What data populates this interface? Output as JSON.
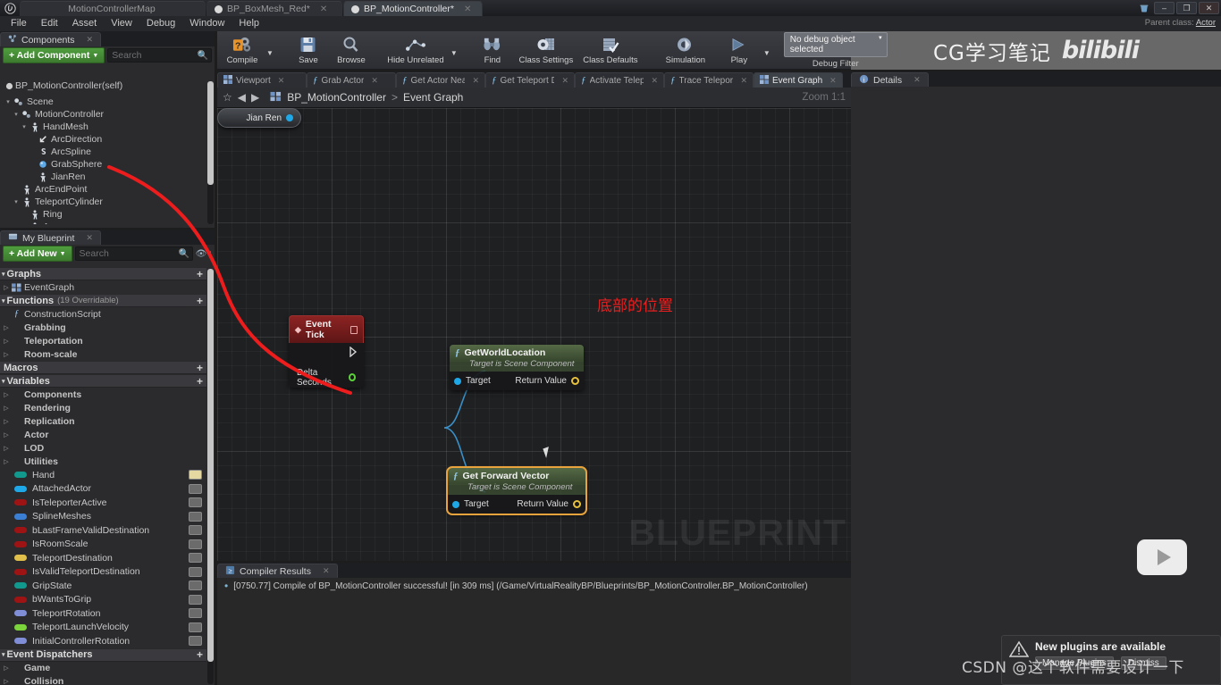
{
  "window": {
    "logo_icon": "unreal-engine-logo",
    "tabs": [
      {
        "label": "MotionControllerMap",
        "active": false,
        "has_dot": false,
        "closable": false
      },
      {
        "label": "BP_BoxMesh_Red*",
        "active": false,
        "has_dot": true,
        "closable": true
      },
      {
        "label": "BP_MotionController*",
        "active": true,
        "has_dot": true,
        "closable": true
      }
    ],
    "controls": {
      "minimize": "–",
      "maximize": "❐",
      "close": "✕",
      "recycle_icon": "recycle-bin-icon"
    }
  },
  "menubar": {
    "items": [
      "File",
      "Edit",
      "Asset",
      "View",
      "Debug",
      "Window",
      "Help"
    ],
    "parent_class_label": "Parent class:",
    "parent_class_value": "Actor"
  },
  "banner": {
    "text": "CG学习笔记",
    "brand": "bilibili"
  },
  "toolbar": {
    "buttons": [
      {
        "label": "Compile",
        "icon": "compile-icon",
        "dropdown": true
      },
      {
        "label": "Save",
        "icon": "save-icon",
        "dropdown": false
      },
      {
        "label": "Browse",
        "icon": "browse-icon",
        "dropdown": false
      },
      {
        "label": "Hide Unrelated",
        "icon": "hide-unrelated-icon",
        "dropdown": true
      },
      {
        "label": "Find",
        "icon": "find-icon",
        "dropdown": false
      },
      {
        "label": "Class Settings",
        "icon": "class-settings-icon",
        "dropdown": false
      },
      {
        "label": "Class Defaults",
        "icon": "class-defaults-icon",
        "dropdown": false
      },
      {
        "label": "Simulation",
        "icon": "simulation-icon",
        "dropdown": false
      },
      {
        "label": "Play",
        "icon": "play-icon",
        "dropdown": true
      }
    ],
    "debug_object_value": "No debug object selected",
    "debug_filter_label": "Debug Filter"
  },
  "components_panel": {
    "tab_label": "Components",
    "tab_icon": "components-icon",
    "add_button": "+ Add Component",
    "search_placeholder": "Search",
    "root": "BP_MotionController(self)",
    "tree": [
      {
        "label": "Scene",
        "depth": 1,
        "arrow": "▾",
        "icon": "scene-icon"
      },
      {
        "label": "MotionController",
        "depth": 2,
        "arrow": "▾",
        "icon": "scene-icon"
      },
      {
        "label": "HandMesh",
        "depth": 3,
        "arrow": "▾",
        "icon": "mesh-icon"
      },
      {
        "label": "ArcDirection",
        "depth": 4,
        "arrow": "",
        "icon": "arrow-icon"
      },
      {
        "label": "ArcSpline",
        "depth": 4,
        "arrow": "",
        "icon": "spline-icon"
      },
      {
        "label": "GrabSphere",
        "depth": 4,
        "arrow": "",
        "icon": "sphere-icon"
      },
      {
        "label": "JianRen",
        "depth": 4,
        "arrow": "",
        "icon": "mesh-icon"
      },
      {
        "label": "ArcEndPoint",
        "depth": 2,
        "arrow": "",
        "icon": "mesh-icon"
      },
      {
        "label": "TeleportCylinder",
        "depth": 2,
        "arrow": "▾",
        "icon": "mesh-icon"
      },
      {
        "label": "Ring",
        "depth": 3,
        "arrow": "",
        "icon": "mesh-icon"
      },
      {
        "label": "Arrow",
        "depth": 3,
        "arrow": "▾",
        "icon": "mesh-icon"
      }
    ]
  },
  "myblueprint_panel": {
    "tab_label": "My Blueprint",
    "tab_icon": "blueprint-icon",
    "add_button": "+ Add New",
    "search_placeholder": "Search",
    "eye_icon": "visibility-icon",
    "sections": [
      {
        "title": "Graphs",
        "arrow": "▾",
        "note": "",
        "plus": true
      },
      {
        "title": "Functions",
        "arrow": "▾",
        "note": "(19 Overridable)",
        "plus": true
      },
      {
        "title": "Macros",
        "arrow": "",
        "note": "",
        "plus": true
      },
      {
        "title": "Variables",
        "arrow": "▾",
        "note": "",
        "plus": true
      },
      {
        "title": "Event Dispatchers",
        "arrow": "▾",
        "note": "",
        "plus": true
      }
    ],
    "graphs": [
      {
        "label": "EventGraph",
        "arrow": "▷",
        "icon": "eventgraph-icon"
      }
    ],
    "functions": [
      {
        "label": "ConstructionScript",
        "arrow": "",
        "icon": "function-icon"
      },
      {
        "label": "Grabbing",
        "arrow": "▷",
        "icon": ""
      },
      {
        "label": "Teleportation",
        "arrow": "▷",
        "icon": ""
      },
      {
        "label": "Room-scale",
        "arrow": "▷",
        "icon": ""
      }
    ],
    "variable_categories": [
      {
        "label": "Components",
        "arrow": "▷"
      },
      {
        "label": "Rendering",
        "arrow": "▷"
      },
      {
        "label": "Replication",
        "arrow": "▷"
      },
      {
        "label": "Actor",
        "arrow": "▷"
      },
      {
        "label": "LOD",
        "arrow": "▷"
      },
      {
        "label": "Utilities",
        "arrow": "▷"
      }
    ],
    "variables": [
      {
        "label": "Hand",
        "color": "#11998e",
        "eye_on": true
      },
      {
        "label": "AttachedActor",
        "color": "#1fa8e8",
        "eye_on": false
      },
      {
        "label": "IsTeleporterActive",
        "color": "#9e1414",
        "eye_on": false
      },
      {
        "label": "SplineMeshes",
        "color": "#3b7fd4",
        "eye_on": false
      },
      {
        "label": "bLastFrameValidDestination",
        "color": "#9e1414",
        "eye_on": false
      },
      {
        "label": "IsRoomScale",
        "color": "#9e1414",
        "eye_on": false
      },
      {
        "label": "TeleportDestination",
        "color": "#e0c04a",
        "eye_on": false
      },
      {
        "label": "IsValidTeleportDestination",
        "color": "#9e1414",
        "eye_on": false
      },
      {
        "label": "GripState",
        "color": "#11998e",
        "eye_on": false
      },
      {
        "label": "bWantsToGrip",
        "color": "#9e1414",
        "eye_on": false
      },
      {
        "label": "TeleportRotation",
        "color": "#7f8ed6",
        "eye_on": false
      },
      {
        "label": "TeleportLaunchVelocity",
        "color": "#7bd43b",
        "eye_on": false
      },
      {
        "label": "InitialControllerRotation",
        "color": "#7f8ed6",
        "eye_on": false
      }
    ],
    "event_dispatchers": [
      {
        "label": "Game",
        "arrow": "▷"
      },
      {
        "label": "Collision",
        "arrow": "▷"
      }
    ]
  },
  "graph_panel": {
    "tabs": [
      {
        "label": "Viewport",
        "icon": "viewport-icon",
        "active": false
      },
      {
        "label": "Grab Actor",
        "icon": "function-icon",
        "active": false
      },
      {
        "label": "Get Actor Near H",
        "icon": "function-icon",
        "active": false
      },
      {
        "label": "Get Teleport Dest",
        "icon": "function-icon",
        "active": false
      },
      {
        "label": "Activate Teleport",
        "icon": "function-icon",
        "active": false
      },
      {
        "label": "Trace Teleport De",
        "icon": "function-icon",
        "active": false
      },
      {
        "label": "Event Graph",
        "icon": "eventgraph-icon",
        "active": true
      }
    ],
    "breadcrumb": {
      "star_icon": "favorite-star-icon",
      "back_icon": "back-arrow-icon",
      "forward_icon": "forward-arrow-icon",
      "graph_icon": "eventgraph-icon",
      "root": "BP_MotionController",
      "separator": ">",
      "current": "Event Graph",
      "zoom_label": "Zoom 1:1"
    },
    "watermark": "BLUEPRINT",
    "annotation": "底部的位置",
    "nodes": [
      {
        "id": "event-tick",
        "title": "Event Tick",
        "subtitle": "",
        "kind": "event",
        "pins_out": [
          "Delta Seconds"
        ],
        "exec_out": true
      },
      {
        "id": "get-world-location",
        "title": "GetWorldLocation",
        "subtitle": "Target is Scene Component",
        "kind": "function",
        "pin_in_label": "Target",
        "pin_out_label": "Return Value",
        "selected": false
      },
      {
        "id": "get-forward-vector",
        "title": "Get Forward Vector",
        "subtitle": "Target is Scene Component",
        "kind": "function",
        "pin_in_label": "Target",
        "pin_out_label": "Return Value",
        "selected": true
      },
      {
        "id": "jian-ren",
        "title": "Jian Ren",
        "kind": "variable-get"
      }
    ]
  },
  "details_panel": {
    "tab_label": "Details",
    "tab_icon": "details-icon"
  },
  "compiler_panel": {
    "tab_label": "Compiler Results",
    "tab_icon": "compiler-icon",
    "messages": [
      "[0750.77] Compile of BP_MotionController successful! [in 309 ms] (/Game/VirtualRealityBP/Blueprints/BP_MotionController.BP_MotionController)"
    ]
  },
  "notification": {
    "warning_icon": "warning-triangle-icon",
    "title": "New plugins are available",
    "buttons": [
      "Manage Plugins",
      "Dismiss"
    ]
  },
  "watermarks": {
    "csdn": "CSDN @这个软件需要设计一下",
    "play_badge_icon": "play-badge-icon"
  },
  "colors": {
    "accent_green": "#4f9d3e",
    "event_red": "#8c2323",
    "selection_orange": "#e8a33d",
    "annotation_red": "#e81f1f",
    "exec_white": "#d6d6d6",
    "object_pin_blue": "#1fa8e8",
    "vector_pin_yellow": "#e8c23d"
  }
}
